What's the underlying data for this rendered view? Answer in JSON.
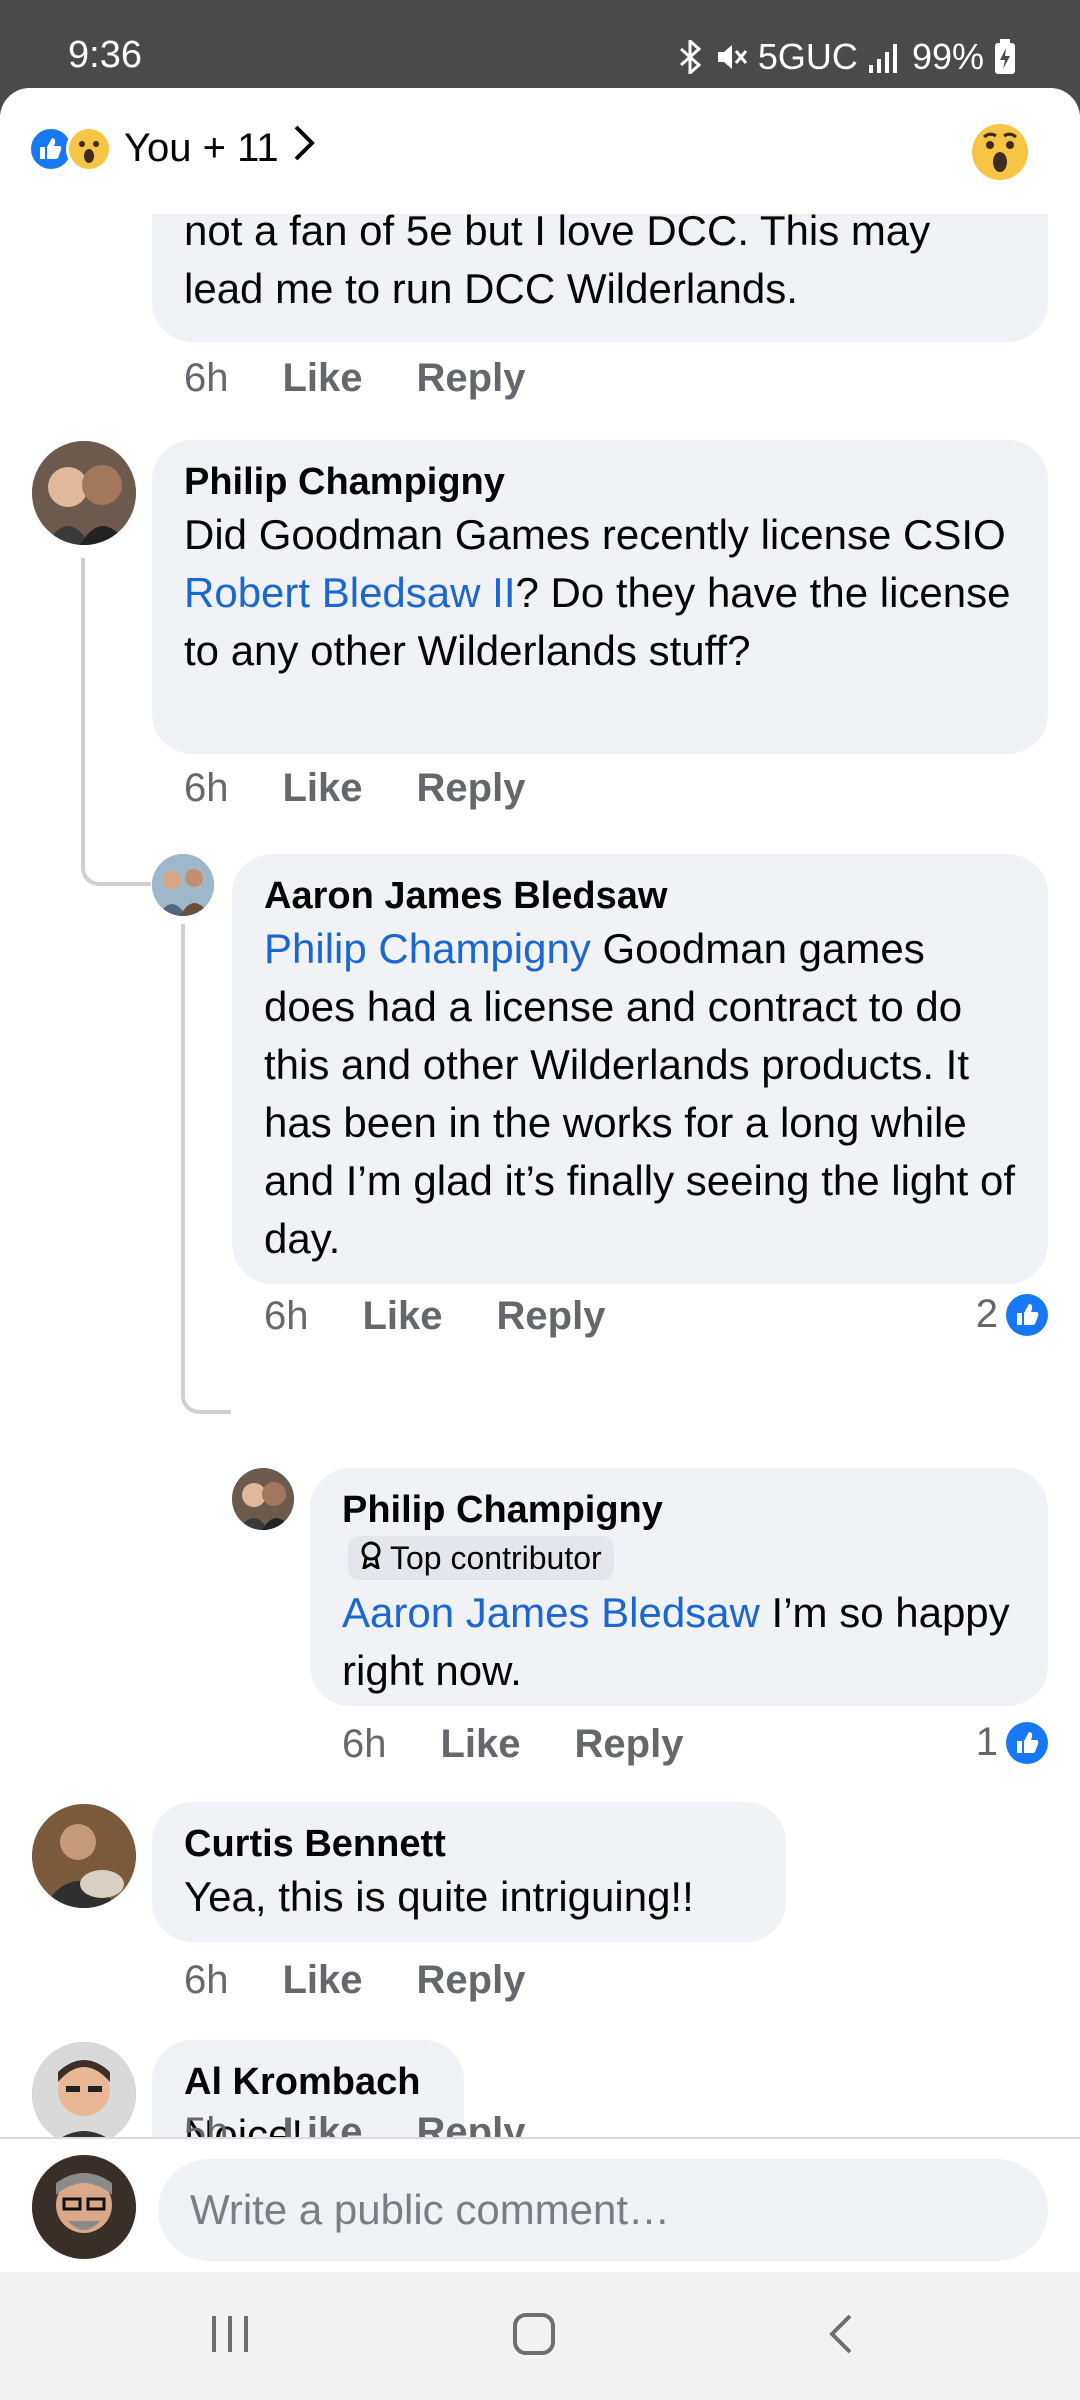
{
  "status_bar": {
    "time": "9:36",
    "network": "5GUC",
    "battery": "99%",
    "icons": [
      "bluetooth-icon",
      "mute-icon",
      "signal-icon",
      "battery-icon"
    ]
  },
  "reactions_header": {
    "summary": "You + 11",
    "reaction_icons": [
      "like-icon",
      "wow-icon"
    ]
  },
  "comments": [
    {
      "id": "c0",
      "text": "not a fan of 5e but I love DCC. This may lead me to run DCC Wilderlands.",
      "time": "6h",
      "like_label": "Like",
      "reply_label": "Reply"
    },
    {
      "id": "c1",
      "author": "Philip Champigny",
      "text_before": "Did Goodman Games recently license CSIO ",
      "mention": "Robert Bledsaw II",
      "text_after": "? Do they have the license to any other Wilderlands stuff?",
      "time": "6h",
      "like_label": "Like",
      "reply_label": "Reply"
    },
    {
      "id": "c2",
      "author": "Aaron James Bledsaw",
      "mention": "Philip Champigny",
      "text_after": " Goodman games does had a license and contract to do this and other Wilderlands products.  It has been in the works for a long while and I’m glad it’s finally seeing the light of day.",
      "time": "6h",
      "like_label": "Like",
      "reply_label": "Reply",
      "reaction_count": "2"
    },
    {
      "id": "c3",
      "author": "Philip Champigny",
      "badge": "Top contributor",
      "mention": "Aaron James Bledsaw",
      "text_after": " I’m so happy right now.",
      "time": "6h",
      "like_label": "Like",
      "reply_label": "Reply",
      "reaction_count": "1"
    },
    {
      "id": "c4",
      "author": "Curtis Bennett",
      "text": "Yea, this is quite intriguing!!",
      "time": "6h",
      "like_label": "Like",
      "reply_label": "Reply"
    },
    {
      "id": "c5",
      "author": "Al Krombach",
      "text": "Noice!",
      "time": "5h",
      "like_label": "Like",
      "reply_label": "Reply"
    }
  ],
  "composer": {
    "placeholder": "Write a public comment…"
  },
  "colors": {
    "accent": "#1877f2",
    "mention": "#1a66d2",
    "bubble": "#f0f2f5",
    "meta_text": "#65676b"
  }
}
